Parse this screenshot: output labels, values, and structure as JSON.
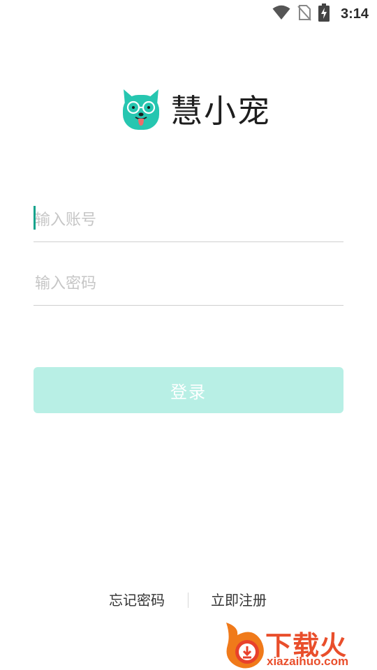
{
  "status_bar": {
    "time": "3:14",
    "icons": [
      "wifi-icon",
      "no-sim-icon",
      "battery-charging-icon"
    ]
  },
  "logo": {
    "app_name": "慧小宠",
    "brand_color": "#26c6b0"
  },
  "form": {
    "account_placeholder": "输入账号",
    "account_value": "",
    "password_placeholder": "输入密码",
    "password_value": ""
  },
  "login_button": {
    "label": "登录",
    "color": "#b8efe5"
  },
  "links": {
    "forgot_password": "忘记密码",
    "register": "立即注册"
  },
  "watermark": {
    "brand": "下载火",
    "domain": "xiazaihuo.com",
    "color": "#e94e2b"
  }
}
